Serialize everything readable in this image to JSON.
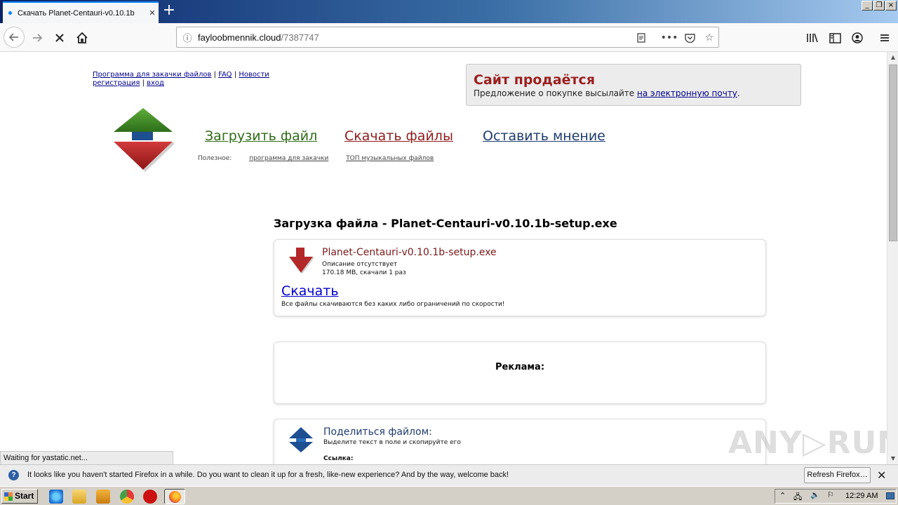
{
  "browser": {
    "tab_title": "Скачать Planet-Centauri-v0.10.1b",
    "url_host": "fayloobmennik.cloud",
    "url_path": "/7387747",
    "status_text": "Waiting for yastatic.net..."
  },
  "toplinks": {
    "download_program": "Программа для закачки файлов",
    "faq": "FAQ",
    "news": "Новости",
    "register": "регистрация",
    "login": "вход",
    "sep": "|"
  },
  "sale": {
    "title": "Сайт продаётся",
    "text": "Предложение о покупке высылайте ",
    "link": "на электронную почту",
    "end": "."
  },
  "nav": {
    "upload": "Загрузить файл",
    "download": "Скачать файлы",
    "feedback": "Оставить мнение",
    "useful_label": "Полезное:",
    "useful_link1": "программа для закачки",
    "useful_link2": "ТОП музыкальных файлов"
  },
  "file": {
    "heading": "Загрузка файла - Planet-Centauri-v0.10.1b-setup.exe",
    "name": "Planet-Centauri-v0.10.1b-setup.exe",
    "description": "Описание отсутствует",
    "size_info": "170.18 MB, скачали 1 раз",
    "download_link": "Скачать",
    "note": "Все файлы скачиваются без каких либо ограничений по скорости!"
  },
  "ad": {
    "label": "Реклама:"
  },
  "share": {
    "title": "Поделиться файлом:",
    "subtitle": "Выделите текст в поле и скопируйте его",
    "link_label": "Ссылка:"
  },
  "watermark": "ANY▷RUN",
  "notification": {
    "message": "It looks like you haven't started Firefox in a while. Do you want to clean it up for a fresh, like-new experience? And by the way, welcome back!",
    "refresh_button": "Refresh Firefox…"
  },
  "taskbar": {
    "start": "Start",
    "clock": "12:29 AM"
  },
  "colors": {
    "logo_green": "#3f8a2a",
    "logo_red": "#b32828",
    "logo_blue": "#1d4f91",
    "nav_upload": "#2e6b16",
    "nav_download": "#8e1c1c",
    "nav_feedback": "#1d3c6e"
  }
}
